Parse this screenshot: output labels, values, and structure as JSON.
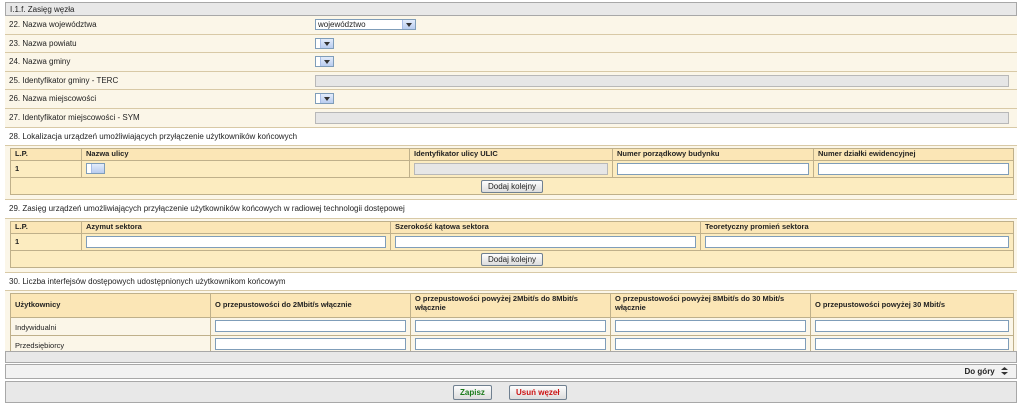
{
  "section_title": "I.1.f. Zasięg węzła",
  "fields": [
    {
      "label": "22. Nazwa województwa",
      "value": "województwo"
    },
    {
      "label": "23. Nazwa powiatu",
      "value": ""
    },
    {
      "label": "24. Nazwa gminy",
      "value": ""
    },
    {
      "label": "25. Identyfikator gminy - TERC",
      "value": ""
    },
    {
      "label": "26. Nazwa miejscowości",
      "value": ""
    },
    {
      "label": "27. Identyfikator miejscowości - SYM",
      "value": ""
    }
  ],
  "s28": {
    "title": "28. Lokalizacja urządzeń umożliwiających przyłączenie użytkowników końcowych",
    "headers": [
      "L.P.",
      "Nazwa ulicy",
      "Identyfikator ulicy ULIC",
      "Numer porządkowy budynku",
      "Numer działki ewidencyjnej"
    ],
    "row_lp": "1",
    "add_label": "Dodaj kolejny"
  },
  "s29": {
    "title": "29. Zasięg urządzeń umożliwiających przyłączenie użytkowników końcowych w radiowej technologii dostępowej",
    "headers": [
      "L.P.",
      "Azymut sektora",
      "Szerokość kątowa sektora",
      "Teoretyczny promień sektora"
    ],
    "row_lp": "1",
    "add_label": "Dodaj kolejny"
  },
  "s30": {
    "title": "30. Liczba interfejsów dostępowych udostępnionych użytkownikom końcowym",
    "headers": [
      "Użytkownicy",
      "O przepustowości do 2Mbit/s włącznie",
      "O przepustowości powyżej 2Mbit/s do 8Mbit/s włącznie",
      "O przepustowości powyżej 8Mbit/s do 30 Mbit/s włącznie",
      "O przepustowości powyżej 30 Mbit/s"
    ],
    "rows": [
      "Indywidualni",
      "Przedsiębiorcy"
    ]
  },
  "to_top": "Do góry",
  "save_label": "Zapisz",
  "delete_label": "Usuń węzeł",
  "colors": {
    "save": "#1a7a1a",
    "delete": "#cc1111"
  }
}
